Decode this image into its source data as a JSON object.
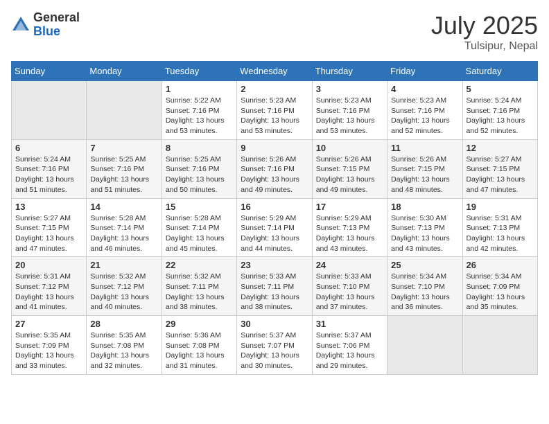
{
  "header": {
    "logo_general": "General",
    "logo_blue": "Blue",
    "title": "July 2025",
    "location": "Tulsipur, Nepal"
  },
  "days_of_week": [
    "Sunday",
    "Monday",
    "Tuesday",
    "Wednesday",
    "Thursday",
    "Friday",
    "Saturday"
  ],
  "weeks": [
    [
      {
        "day": "",
        "empty": true
      },
      {
        "day": "",
        "empty": true
      },
      {
        "day": "1",
        "sunrise": "Sunrise: 5:22 AM",
        "sunset": "Sunset: 7:16 PM",
        "daylight": "Daylight: 13 hours and 53 minutes."
      },
      {
        "day": "2",
        "sunrise": "Sunrise: 5:23 AM",
        "sunset": "Sunset: 7:16 PM",
        "daylight": "Daylight: 13 hours and 53 minutes."
      },
      {
        "day": "3",
        "sunrise": "Sunrise: 5:23 AM",
        "sunset": "Sunset: 7:16 PM",
        "daylight": "Daylight: 13 hours and 53 minutes."
      },
      {
        "day": "4",
        "sunrise": "Sunrise: 5:23 AM",
        "sunset": "Sunset: 7:16 PM",
        "daylight": "Daylight: 13 hours and 52 minutes."
      },
      {
        "day": "5",
        "sunrise": "Sunrise: 5:24 AM",
        "sunset": "Sunset: 7:16 PM",
        "daylight": "Daylight: 13 hours and 52 minutes."
      }
    ],
    [
      {
        "day": "6",
        "sunrise": "Sunrise: 5:24 AM",
        "sunset": "Sunset: 7:16 PM",
        "daylight": "Daylight: 13 hours and 51 minutes."
      },
      {
        "day": "7",
        "sunrise": "Sunrise: 5:25 AM",
        "sunset": "Sunset: 7:16 PM",
        "daylight": "Daylight: 13 hours and 51 minutes."
      },
      {
        "day": "8",
        "sunrise": "Sunrise: 5:25 AM",
        "sunset": "Sunset: 7:16 PM",
        "daylight": "Daylight: 13 hours and 50 minutes."
      },
      {
        "day": "9",
        "sunrise": "Sunrise: 5:26 AM",
        "sunset": "Sunset: 7:16 PM",
        "daylight": "Daylight: 13 hours and 49 minutes."
      },
      {
        "day": "10",
        "sunrise": "Sunrise: 5:26 AM",
        "sunset": "Sunset: 7:15 PM",
        "daylight": "Daylight: 13 hours and 49 minutes."
      },
      {
        "day": "11",
        "sunrise": "Sunrise: 5:26 AM",
        "sunset": "Sunset: 7:15 PM",
        "daylight": "Daylight: 13 hours and 48 minutes."
      },
      {
        "day": "12",
        "sunrise": "Sunrise: 5:27 AM",
        "sunset": "Sunset: 7:15 PM",
        "daylight": "Daylight: 13 hours and 47 minutes."
      }
    ],
    [
      {
        "day": "13",
        "sunrise": "Sunrise: 5:27 AM",
        "sunset": "Sunset: 7:15 PM",
        "daylight": "Daylight: 13 hours and 47 minutes."
      },
      {
        "day": "14",
        "sunrise": "Sunrise: 5:28 AM",
        "sunset": "Sunset: 7:14 PM",
        "daylight": "Daylight: 13 hours and 46 minutes."
      },
      {
        "day": "15",
        "sunrise": "Sunrise: 5:28 AM",
        "sunset": "Sunset: 7:14 PM",
        "daylight": "Daylight: 13 hours and 45 minutes."
      },
      {
        "day": "16",
        "sunrise": "Sunrise: 5:29 AM",
        "sunset": "Sunset: 7:14 PM",
        "daylight": "Daylight: 13 hours and 44 minutes."
      },
      {
        "day": "17",
        "sunrise": "Sunrise: 5:29 AM",
        "sunset": "Sunset: 7:13 PM",
        "daylight": "Daylight: 13 hours and 43 minutes."
      },
      {
        "day": "18",
        "sunrise": "Sunrise: 5:30 AM",
        "sunset": "Sunset: 7:13 PM",
        "daylight": "Daylight: 13 hours and 43 minutes."
      },
      {
        "day": "19",
        "sunrise": "Sunrise: 5:31 AM",
        "sunset": "Sunset: 7:13 PM",
        "daylight": "Daylight: 13 hours and 42 minutes."
      }
    ],
    [
      {
        "day": "20",
        "sunrise": "Sunrise: 5:31 AM",
        "sunset": "Sunset: 7:12 PM",
        "daylight": "Daylight: 13 hours and 41 minutes."
      },
      {
        "day": "21",
        "sunrise": "Sunrise: 5:32 AM",
        "sunset": "Sunset: 7:12 PM",
        "daylight": "Daylight: 13 hours and 40 minutes."
      },
      {
        "day": "22",
        "sunrise": "Sunrise: 5:32 AM",
        "sunset": "Sunset: 7:11 PM",
        "daylight": "Daylight: 13 hours and 38 minutes."
      },
      {
        "day": "23",
        "sunrise": "Sunrise: 5:33 AM",
        "sunset": "Sunset: 7:11 PM",
        "daylight": "Daylight: 13 hours and 38 minutes."
      },
      {
        "day": "24",
        "sunrise": "Sunrise: 5:33 AM",
        "sunset": "Sunset: 7:10 PM",
        "daylight": "Daylight: 13 hours and 37 minutes."
      },
      {
        "day": "25",
        "sunrise": "Sunrise: 5:34 AM",
        "sunset": "Sunset: 7:10 PM",
        "daylight": "Daylight: 13 hours and 36 minutes."
      },
      {
        "day": "26",
        "sunrise": "Sunrise: 5:34 AM",
        "sunset": "Sunset: 7:09 PM",
        "daylight": "Daylight: 13 hours and 35 minutes."
      }
    ],
    [
      {
        "day": "27",
        "sunrise": "Sunrise: 5:35 AM",
        "sunset": "Sunset: 7:09 PM",
        "daylight": "Daylight: 13 hours and 33 minutes."
      },
      {
        "day": "28",
        "sunrise": "Sunrise: 5:35 AM",
        "sunset": "Sunset: 7:08 PM",
        "daylight": "Daylight: 13 hours and 32 minutes."
      },
      {
        "day": "29",
        "sunrise": "Sunrise: 5:36 AM",
        "sunset": "Sunset: 7:08 PM",
        "daylight": "Daylight: 13 hours and 31 minutes."
      },
      {
        "day": "30",
        "sunrise": "Sunrise: 5:37 AM",
        "sunset": "Sunset: 7:07 PM",
        "daylight": "Daylight: 13 hours and 30 minutes."
      },
      {
        "day": "31",
        "sunrise": "Sunrise: 5:37 AM",
        "sunset": "Sunset: 7:06 PM",
        "daylight": "Daylight: 13 hours and 29 minutes."
      },
      {
        "day": "",
        "empty": true
      },
      {
        "day": "",
        "empty": true
      }
    ]
  ]
}
